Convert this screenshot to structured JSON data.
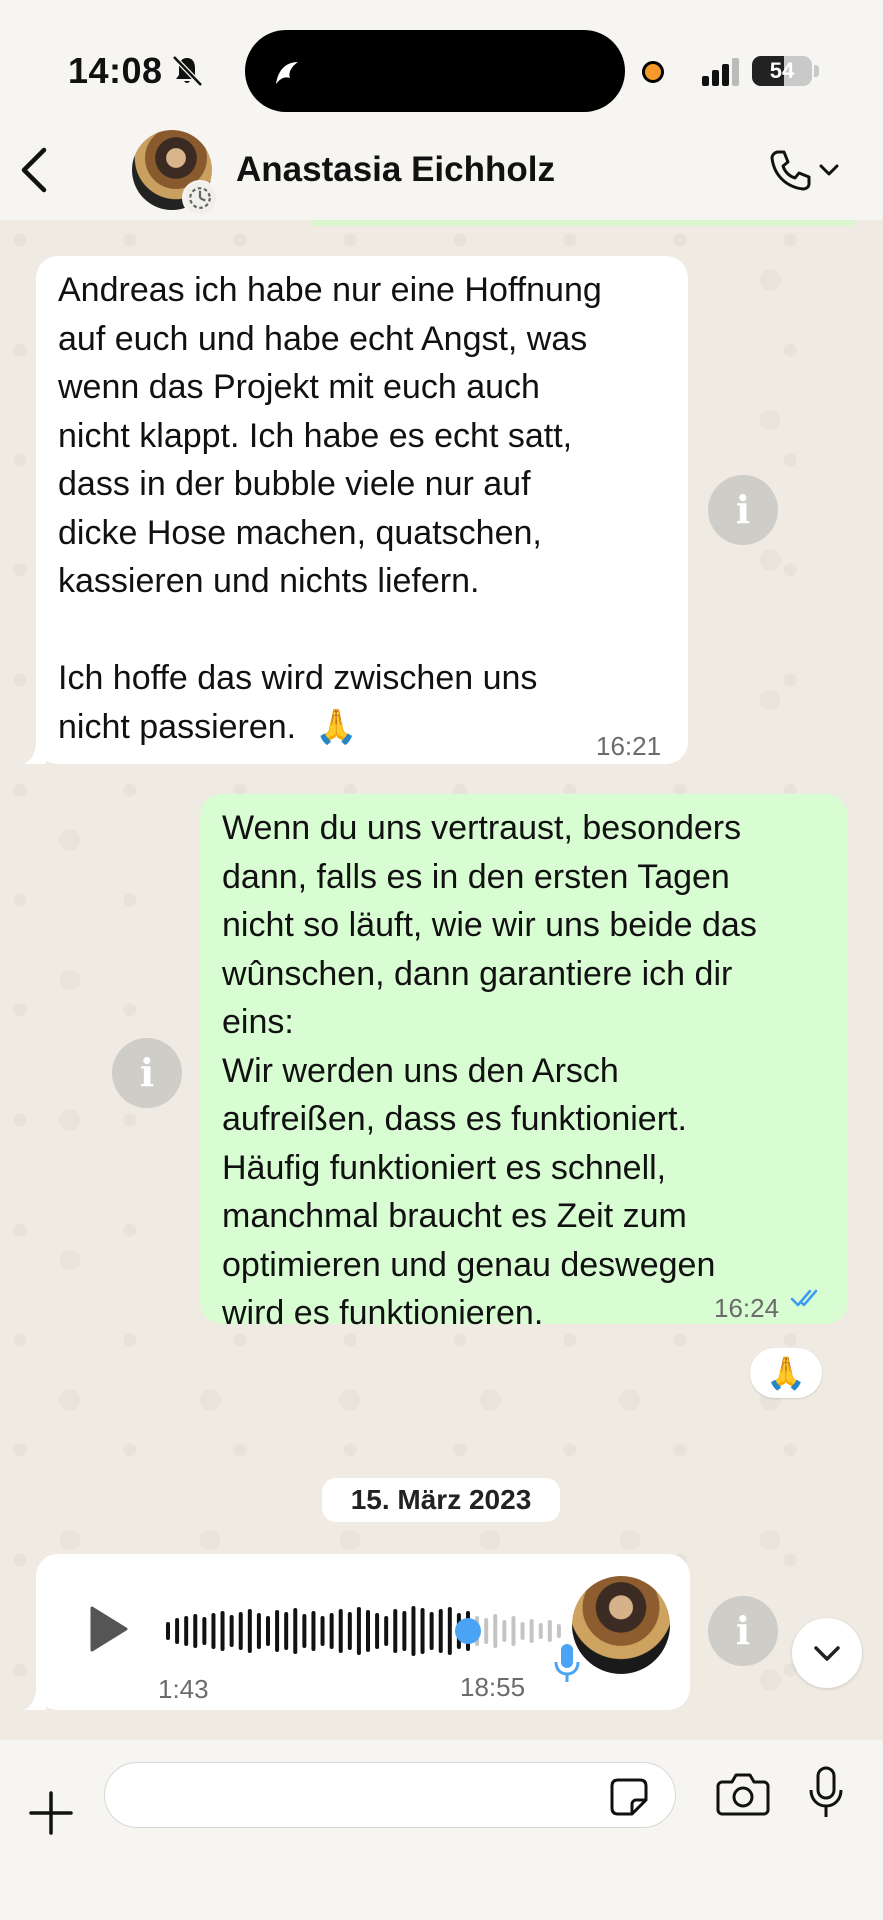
{
  "status_bar": {
    "time": "14:08",
    "battery_level": "54",
    "battery_percent": 54
  },
  "header": {
    "contact_name": "Anastasia Eichholz"
  },
  "messages": [
    {
      "direction": "incoming",
      "text": "Andreas ich habe nur eine Hoffnung\nauf euch und habe echt Angst, was\nwenn das Projekt mit euch auch\nnicht klappt. Ich habe es echt satt,\ndass in der bubble viele nur auf\ndicke Hose machen, quatschen,\nkassieren und nichts liefern.\n\nIch hoffe das wird zwischen uns\nnicht passieren.  🙏",
      "time": "16:21"
    },
    {
      "direction": "outgoing",
      "text": "Wenn du uns vertraust, besonders\ndann, falls es in den ersten Tagen\nnicht so läuft, wie wir uns beide das\nwûnschen, dann garantiere ich dir\neins:\nWir werden uns den Arsch\naufreißen, dass es funktioniert.\nHäufig funktioniert es schnell,\nmanchmal braucht es Zeit zum\noptimieren und genau deswegen\nwird es funktionieren.",
      "time": "16:24",
      "read_status": "read",
      "reaction": "🙏"
    }
  ],
  "date_separator": "15. März 2023",
  "voice_message": {
    "duration": "1:43",
    "time": "18:55",
    "progress": 0.76
  },
  "info_icon_glyph": "i",
  "composer": {
    "placeholder": "",
    "value": ""
  },
  "colors": {
    "incoming_bubble": "#ffffff",
    "outgoing_bubble": "#d9fdd3",
    "read_ticks": "#3b9cf0",
    "voice_progress": "#4aa3f5"
  }
}
